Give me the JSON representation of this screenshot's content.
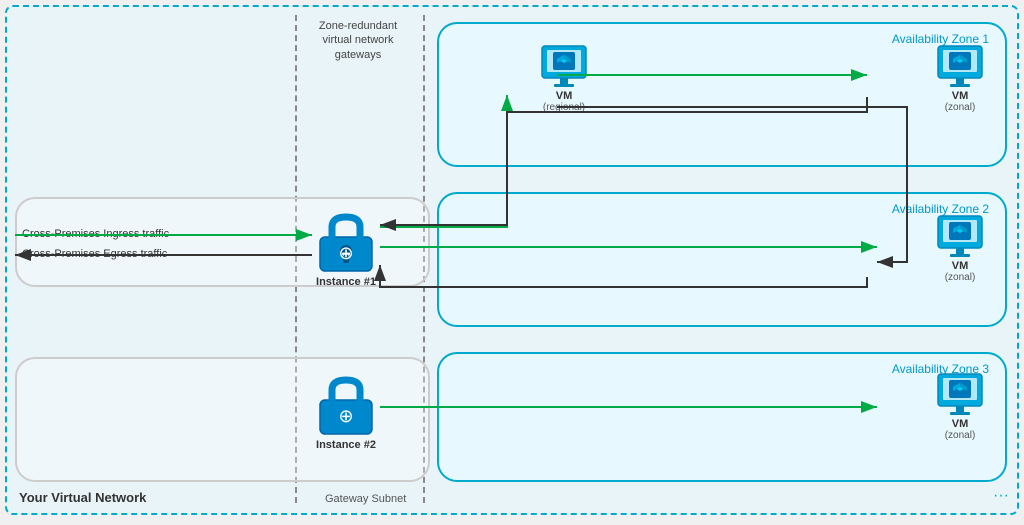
{
  "diagram": {
    "outer_label": "Your Virtual Network",
    "gateway_subnet_label": "Gateway Subnet",
    "gateway_subnet_text": "Zone-redundant virtual network gateways",
    "zones": [
      {
        "id": "zone1",
        "label": "Availability Zone 1"
      },
      {
        "id": "zone2",
        "label": "Availability Zone 2"
      },
      {
        "id": "zone3",
        "label": "Availability Zone 3"
      }
    ],
    "instances": [
      {
        "id": "instance1",
        "label": "Instance #1"
      },
      {
        "id": "instance2",
        "label": "Instance #2"
      }
    ],
    "vms": [
      {
        "id": "vm-regional",
        "label": "VM",
        "sublabel": "(regional)"
      },
      {
        "id": "vm-zonal1",
        "label": "VM",
        "sublabel": "(zonal)"
      },
      {
        "id": "vm-zonal2",
        "label": "VM",
        "sublabel": "(zonal)"
      },
      {
        "id": "vm-zonal3",
        "label": "VM",
        "sublabel": "(zonal)"
      }
    ],
    "traffic_labels": [
      "Cross-Premises Ingress traffic",
      "Cross-Premises Egress traffic"
    ]
  }
}
